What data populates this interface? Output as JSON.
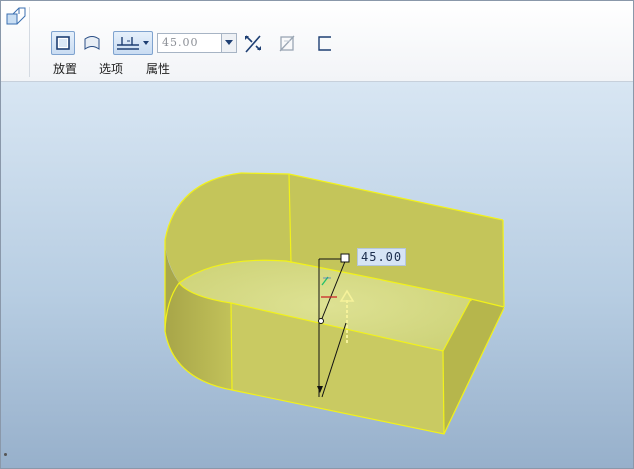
{
  "dashboard": {
    "tabs": [
      {
        "label": "放置"
      },
      {
        "label": "选项"
      },
      {
        "label": "属性"
      }
    ],
    "angle_value": "45.00",
    "icons": [
      "feature-icon",
      "solid-icon",
      "surface-icon",
      "through-all-icon",
      "dropdown-icon",
      "flip-direction-icon",
      "remove-material-icon",
      "thicken-icon"
    ]
  },
  "viewport": {
    "dimension_label": "45.00",
    "colors": {
      "model_fill": "#c8c860",
      "model_edge": "#ffff00",
      "background_top": "#d8e6f3",
      "background_bottom": "#97b0cb"
    }
  }
}
